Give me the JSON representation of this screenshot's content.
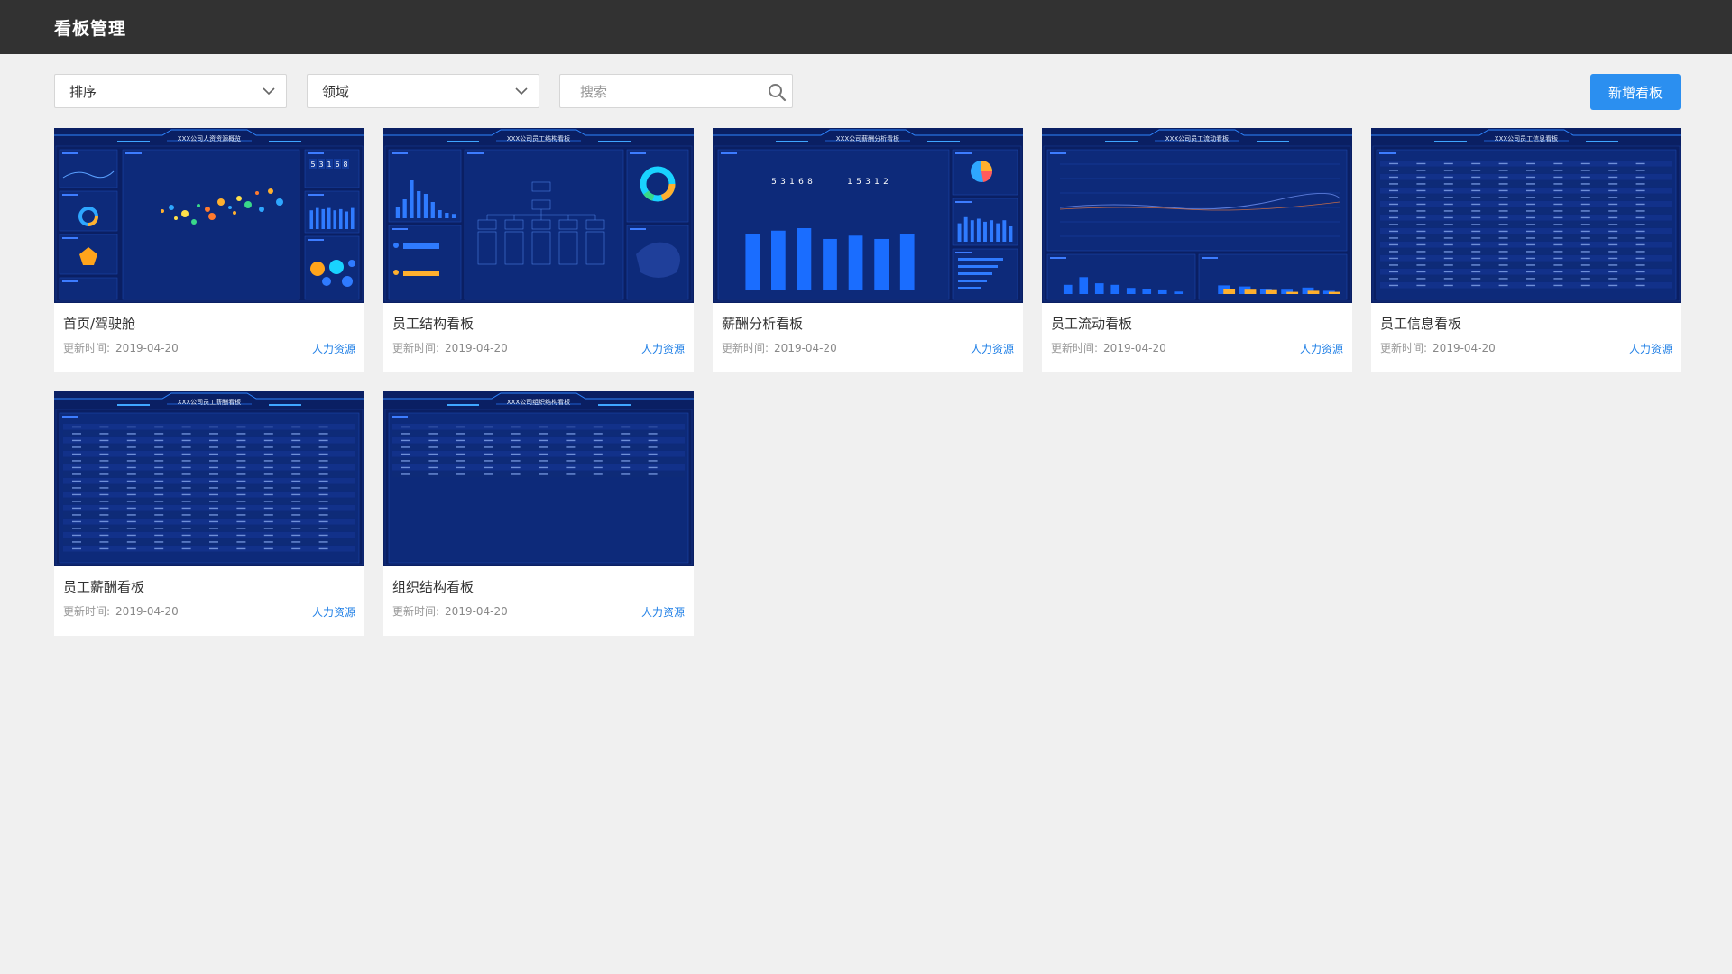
{
  "header": {
    "title": "看板管理"
  },
  "toolbar": {
    "sort_label": "排序",
    "domain_label": "领域",
    "search_placeholder": "搜索",
    "add_label": "新增看板",
    "icons": [
      "chevron-down-icon",
      "search-icon"
    ]
  },
  "colors": {
    "accent": "#2b8ff0",
    "topbar": "#323232",
    "thumb_bg": "#0c2268",
    "tag": "#1f7fe6"
  },
  "time_label": "更新时间:",
  "cards": [
    {
      "name": "首页/驾驶舱",
      "updated": "2019-04-20",
      "tag": "人力资源",
      "thumb_title": "XXX公司人资资源概览",
      "kind": "cockpit",
      "numbers": [
        "5",
        "3",
        "1",
        "6",
        "8"
      ]
    },
    {
      "name": "员工结构看板",
      "updated": "2019-04-20",
      "tag": "人力资源",
      "thumb_title": "XXX公司员工结构看板",
      "kind": "structure"
    },
    {
      "name": "薪酬分析看板",
      "updated": "2019-04-20",
      "tag": "人力资源",
      "thumb_title": "XXX公司薪酬分析看板",
      "kind": "salary",
      "numbers": [
        "5",
        "3",
        "1",
        "6",
        "8"
      ],
      "numbers2": [
        "1",
        "5",
        "3",
        "1",
        "2"
      ]
    },
    {
      "name": "员工流动看板",
      "updated": "2019-04-20",
      "tag": "人力资源",
      "thumb_title": "XXX公司员工流动看板",
      "kind": "flow"
    },
    {
      "name": "员工信息看板",
      "updated": "2019-04-20",
      "tag": "人力资源",
      "thumb_title": "XXX公司员工信息看板",
      "kind": "table"
    },
    {
      "name": "员工薪酬看板",
      "updated": "2019-04-20",
      "tag": "人力资源",
      "thumb_title": "XXX公司员工薪酬看板",
      "kind": "table"
    },
    {
      "name": "组织结构看板",
      "updated": "2019-04-20",
      "tag": "人力资源",
      "thumb_title": "XXX公司组织结构看板",
      "kind": "table-short"
    }
  ]
}
